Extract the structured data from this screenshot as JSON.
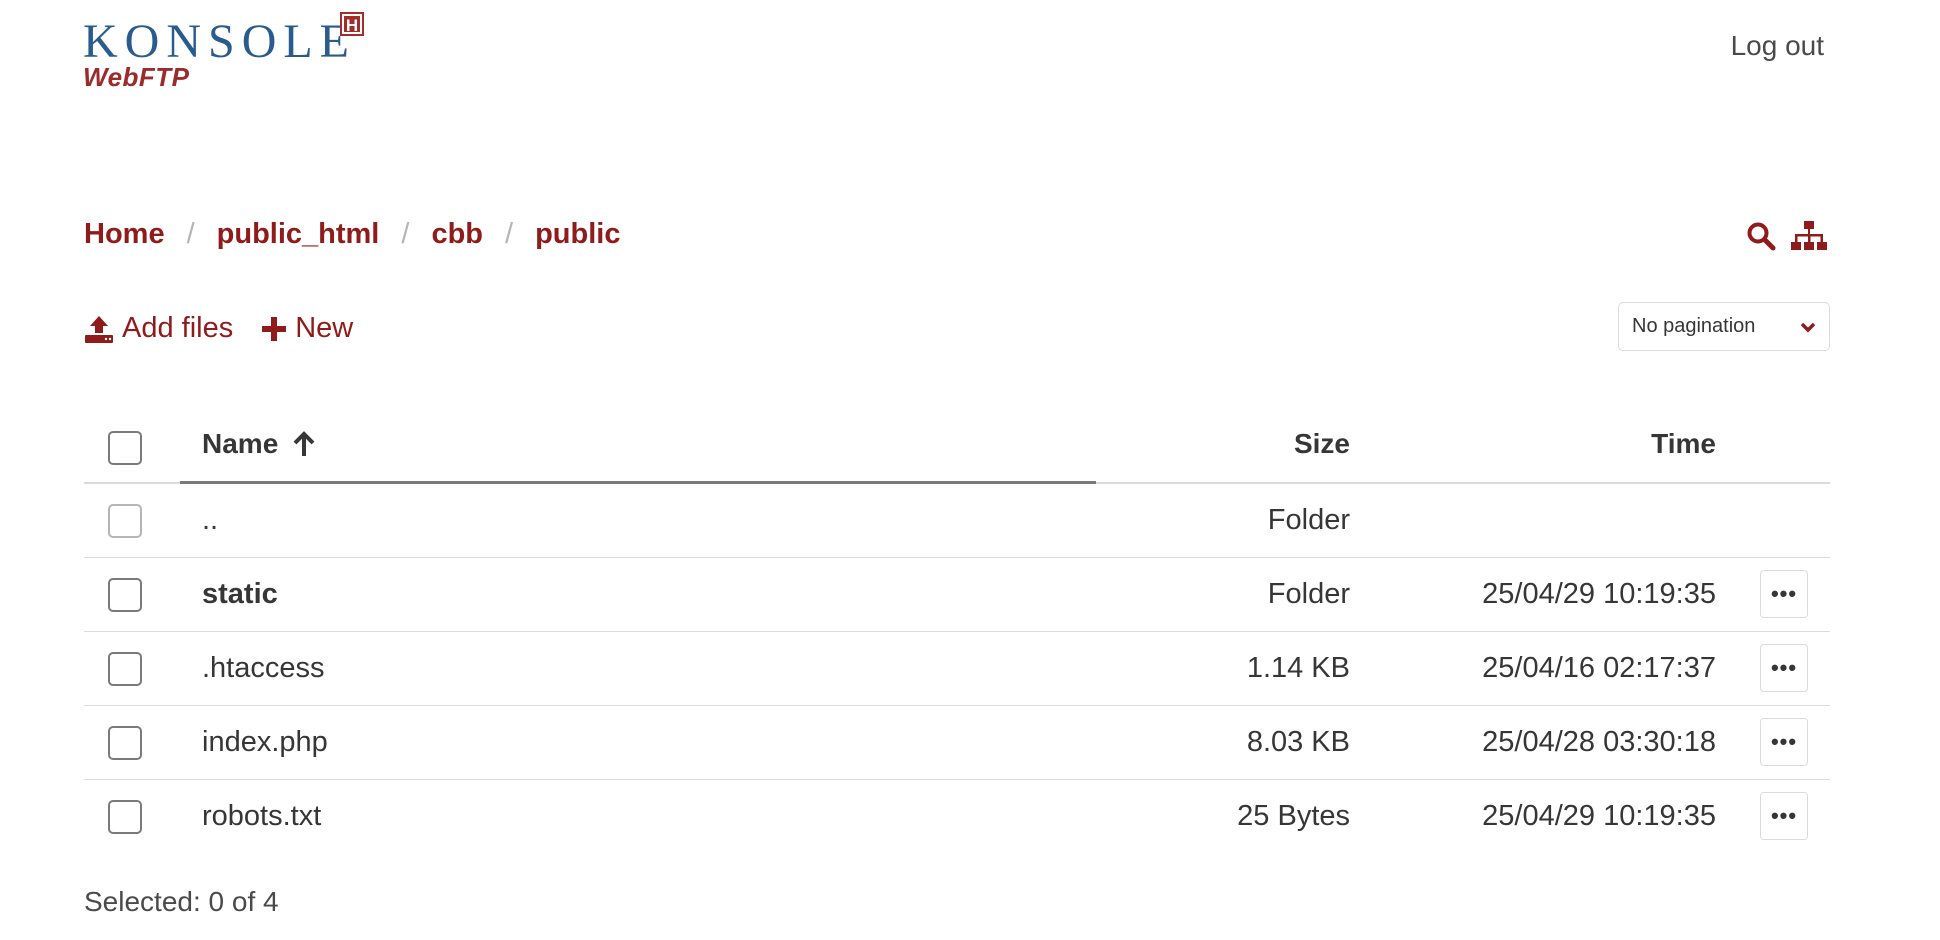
{
  "app": {
    "logo_word": "KONSOLE",
    "logo_badge": "H",
    "logo_sub": "WebFTP",
    "logout_label": "Log out"
  },
  "breadcrumb": [
    "Home",
    "public_html",
    "cbb",
    "public"
  ],
  "toolbar": {
    "add_files_label": "Add files",
    "new_label": "New",
    "pagination_label": "No pagination"
  },
  "table": {
    "headers": {
      "name": "Name",
      "size": "Size",
      "time": "Time"
    },
    "rows": [
      {
        "name": "..",
        "size": "Folder",
        "time": "",
        "bold": false,
        "parent": true
      },
      {
        "name": "static",
        "size": "Folder",
        "time": "25/04/29 10:19:35",
        "bold": true
      },
      {
        "name": ".htaccess",
        "size": "1.14 KB",
        "time": "25/04/16 02:17:37",
        "bold": false
      },
      {
        "name": "index.php",
        "size": "8.03 KB",
        "time": "25/04/28 03:30:18",
        "bold": false
      },
      {
        "name": "robots.txt",
        "size": "25 Bytes",
        "time": "25/04/29 10:19:35",
        "bold": false
      }
    ]
  },
  "status": {
    "selected_text": "Selected: 0 of 4"
  },
  "colors": {
    "accent": "#8f1b1b",
    "logo_blue": "#2a5b8f",
    "border": "#dbdbdb"
  }
}
